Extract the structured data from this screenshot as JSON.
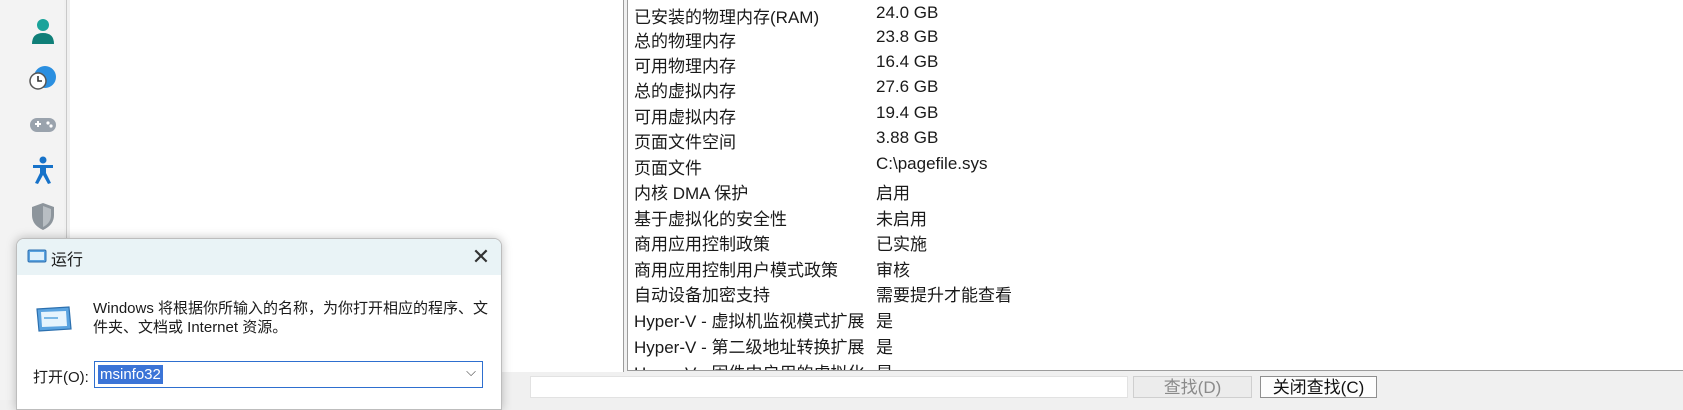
{
  "sidebar": {
    "icons": [
      "accounts-icon",
      "time-language-icon",
      "gaming-icon",
      "accessibility-icon",
      "privacy-security-icon"
    ]
  },
  "details": {
    "rows": [
      {
        "item": "已安装的物理内存(RAM)",
        "value": "24.0 GB"
      },
      {
        "item": "总的物理内存",
        "value": "23.8 GB"
      },
      {
        "item": "可用物理内存",
        "value": "16.4 GB"
      },
      {
        "item": "总的虚拟内存",
        "value": "27.6 GB"
      },
      {
        "item": "可用虚拟内存",
        "value": "19.4 GB"
      },
      {
        "item": "页面文件空间",
        "value": "3.88 GB"
      },
      {
        "item": "页面文件",
        "value": "C:\\pagefile.sys"
      },
      {
        "item": "内核 DMA 保护",
        "value": "启用"
      },
      {
        "item": "基于虚拟化的安全性",
        "value": "未启用"
      },
      {
        "item": "商用应用控制政策",
        "value": "已实施"
      },
      {
        "item": "商用应用控制用户模式政策",
        "value": "审核"
      },
      {
        "item": "自动设备加密支持",
        "value": "需要提升才能查看"
      },
      {
        "item": "Hyper-V - 虚拟机监视模式扩展",
        "value": "是"
      },
      {
        "item": "Hyper-V - 第二级地址转换扩展",
        "value": "是"
      },
      {
        "item": "Hyper-V - 固件中启用的虚拟化",
        "value": "是"
      }
    ]
  },
  "findbar": {
    "search_value": "",
    "find_label": "查找(D)",
    "close_find_label": "关闭查找(C)"
  },
  "run_dialog": {
    "title": "运行",
    "close_symbol": "✕",
    "description": "Windows 将根据你所输入的名称，为你打开相应的程序、文件夹、文档或 Internet 资源。",
    "open_label": "打开(O):",
    "open_value": "msinfo32",
    "dropdown_symbol": "⌵"
  }
}
